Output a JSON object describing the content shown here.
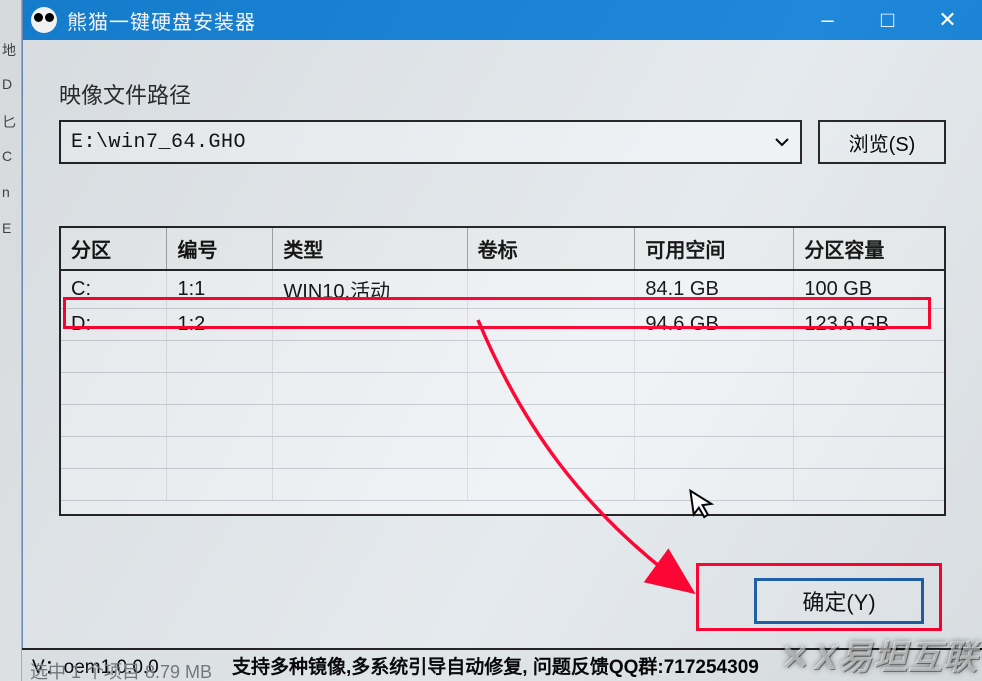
{
  "window": {
    "title": "熊猫一键硬盘安装器",
    "minimize_icon": "–",
    "maximize_icon": "□",
    "close_icon": "✕"
  },
  "path": {
    "label": "映像文件路径",
    "value": "E:\\win7_64.GHO",
    "browse_label": "浏览(S)"
  },
  "table": {
    "headers": {
      "partition": "分区",
      "number": "编号",
      "type": "类型",
      "label": "卷标",
      "free": "可用空间",
      "capacity": "分区容量"
    },
    "rows": [
      {
        "partition": "C:",
        "number": "1:1",
        "type": "WIN10,活动",
        "label": "",
        "free": "84.1 GB",
        "capacity": "100 GB"
      },
      {
        "partition": "D:",
        "number": "1:2",
        "type": "",
        "label": "",
        "free": "94.6 GB",
        "capacity": "123.6 GB"
      }
    ]
  },
  "ok_label": "确定(Y)",
  "status": {
    "version": "V：oem1.0.0.0",
    "message": "支持多种镜像,多系统引导自动修复, 问题反馈QQ群:717254309"
  },
  "below_text": "选中 1 个项目  8.79 MB",
  "watermark": "X易坦互联",
  "colors": {
    "titlebar": "#1683d8",
    "annotation": "#ff0030",
    "ok_border": "#1d5fa8"
  }
}
